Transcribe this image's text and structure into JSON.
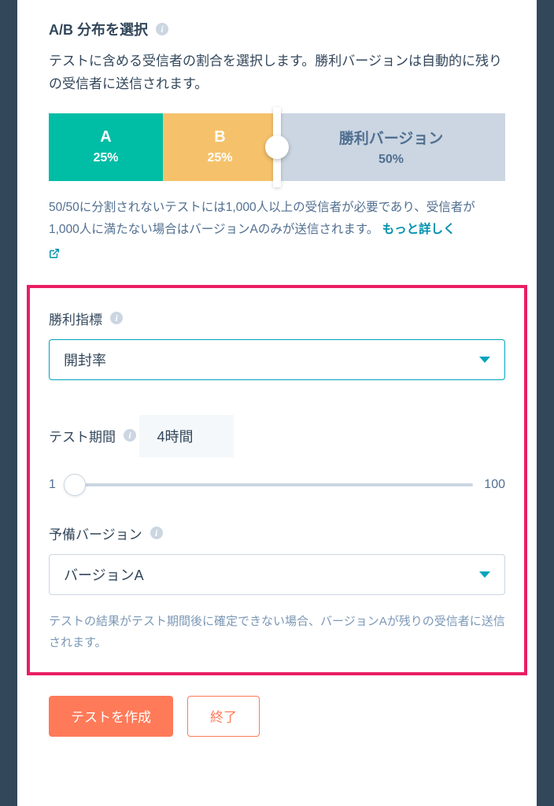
{
  "abSection": {
    "title": "A/B 分布を選択",
    "description": "テストに含める受信者の割合を選択します。勝利バージョンは自動的に残りの受信者に送信されます。",
    "segments": {
      "a": {
        "label": "A",
        "percent": "25%"
      },
      "b": {
        "label": "B",
        "percent": "25%"
      },
      "winner": {
        "label": "勝利バージョン",
        "percent": "50%"
      }
    },
    "noteText": "50/50に分割されないテストには1,000人以上の受信者が必要であり、受信者が1,000人に満たない場合はバージョンAのみが送信されます。",
    "moreLink": "もっと詳しく"
  },
  "metric": {
    "label": "勝利指標",
    "value": "開封率"
  },
  "duration": {
    "label": "テスト期間",
    "value": "4時間",
    "min": "1",
    "max": "100"
  },
  "fallback": {
    "label": "予備バージョン",
    "value": "バージョンA",
    "note": "テストの結果がテスト期間後に確定できない場合、バージョンAが残りの受信者に送信されます。"
  },
  "buttons": {
    "create": "テストを作成",
    "exit": "終了"
  }
}
